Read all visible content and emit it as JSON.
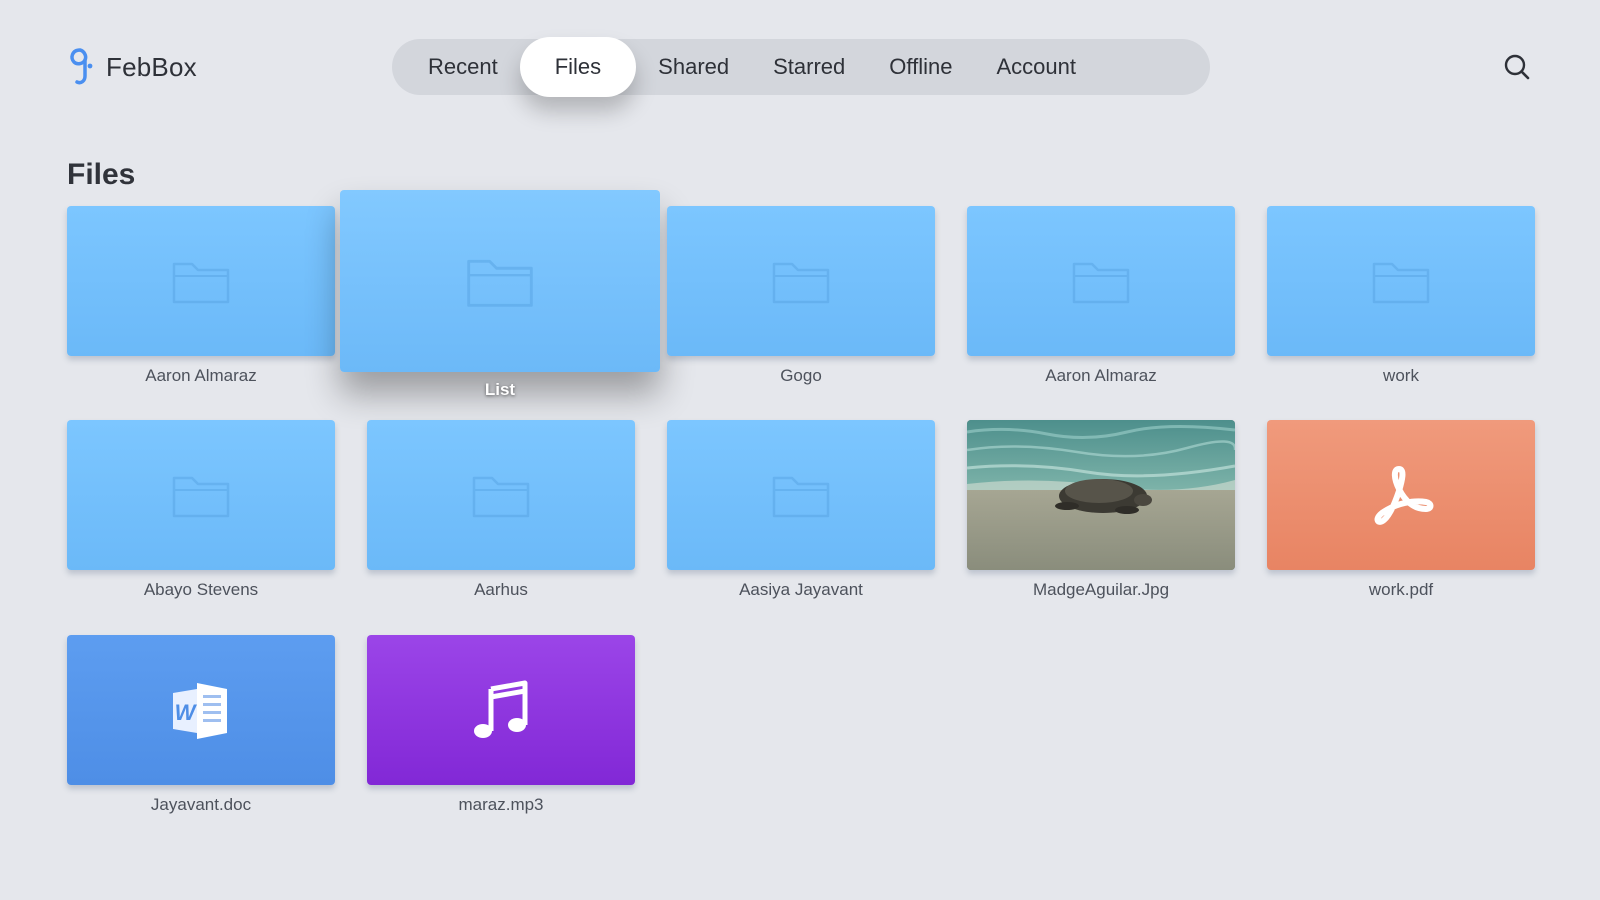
{
  "app": {
    "name": "FebBox"
  },
  "nav": {
    "tabs": [
      {
        "label": "Recent",
        "active": false
      },
      {
        "label": "Files",
        "active": true
      },
      {
        "label": "Shared",
        "active": false
      },
      {
        "label": "Starred",
        "active": false
      },
      {
        "label": "Offline",
        "active": false
      },
      {
        "label": "Account",
        "active": false
      }
    ]
  },
  "search": {
    "icon": "search-icon"
  },
  "section": {
    "title": "Files"
  },
  "files": [
    {
      "name": "Aaron Almaraz",
      "type": "folder",
      "icon": "folder-icon"
    },
    {
      "name": "List",
      "type": "folder",
      "icon": "folder-icon",
      "focused": true
    },
    {
      "name": "Gogo",
      "type": "folder",
      "icon": "folder-icon"
    },
    {
      "name": "Aaron Almaraz",
      "type": "folder",
      "icon": "folder-icon"
    },
    {
      "name": "work",
      "type": "folder",
      "icon": "folder-icon"
    },
    {
      "name": "Abayo Stevens",
      "type": "folder",
      "icon": "folder-icon"
    },
    {
      "name": "Aarhus",
      "type": "folder",
      "icon": "folder-icon"
    },
    {
      "name": "Aasiya Jayavant",
      "type": "folder",
      "icon": "folder-icon"
    },
    {
      "name": "MadgeAguilar.Jpg",
      "type": "image",
      "icon": "image-thumbnail"
    },
    {
      "name": "work.pdf",
      "type": "pdf",
      "icon": "pdf-icon"
    },
    {
      "name": "Jayavant.doc",
      "type": "doc",
      "icon": "word-doc-icon"
    },
    {
      "name": "maraz.mp3",
      "type": "audio",
      "icon": "music-note-icon"
    }
  ],
  "colors": {
    "background": "#e5e7ec",
    "folder": "#74c0fc",
    "pdf": "#ec8d6d",
    "doc": "#5596ec",
    "audio": "#8e33de",
    "brand": "#4a8ff0"
  }
}
